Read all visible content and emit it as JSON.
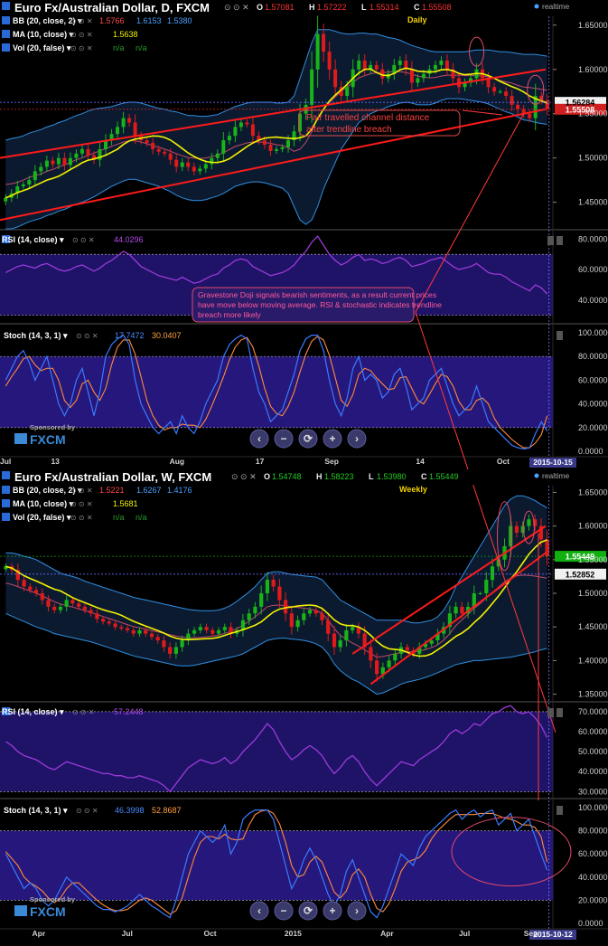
{
  "colors": {
    "bg": "#000000",
    "bb_fill": "#0c1a30",
    "bb_line": "#2f8fe0",
    "bb_mid": "#c04a6a",
    "ma": "#f2f200",
    "up": "#18b418",
    "down": "#e01a1a",
    "channel": "#ff1a1a",
    "rsi": "#9a3ad8",
    "stoch_k": "#3a7aff",
    "stoch_d": "#ff8a3a",
    "osc_fill": "#2a1a8a",
    "axis_text": "#d0d0d0",
    "grid": "#5a5a9a"
  },
  "charts": [
    {
      "id": "daily",
      "header": {
        "title": "Euro Fx/Australian Dollar, D, FXCM",
        "o_label": "O",
        "o": "1.57081",
        "h_label": "H",
        "h": "1.57222",
        "l_label": "L",
        "l": "1.55314",
        "c_label": "C",
        "c": "1.55508",
        "realtime": "realtime",
        "timeframe": "Daily"
      },
      "studies": [
        {
          "label": "BB (20, close, 2)",
          "v1": "1.5766",
          "v2": "1.6153",
          "v3": "1.5380"
        },
        {
          "label": "MA (10, close)",
          "v1": "1.5638"
        },
        {
          "label": "Vol (20, false)",
          "v1": "n/a",
          "v2": "n/a"
        }
      ],
      "price_ticks": [
        "1.65000",
        "1.60000",
        "1.55000",
        "1.50000",
        "1.45000"
      ],
      "price_badges": [
        "1.56284",
        "1.55508"
      ],
      "annotation": "Pair travelled channel distance after trendline breach",
      "rsi": {
        "label": "RSI (14, close)",
        "value": "44.0296",
        "ticks": [
          "80.0000",
          "60.0000",
          "40.0000"
        ]
      },
      "rsi_annotation": "Gravestone Doji signals bearish sentiments, as a result current prices have move below moving average. RSI & stochastic indicates trendline breach more likely",
      "stoch": {
        "label": "Stoch (14, 3, 1)",
        "k": "17.7472",
        "d": "30.0407",
        "ticks": [
          "100.0000",
          "80.0000",
          "60.0000",
          "40.0000",
          "20.0000",
          "0.0000"
        ]
      },
      "sponsor": {
        "top": "Sponsored by",
        "brand": "FXCM"
      },
      "x_labels": [
        "Jul",
        "13",
        "Aug",
        "17",
        "Sep",
        "14",
        "Oct"
      ],
      "date_badge": "2015-10-15"
    },
    {
      "id": "weekly",
      "header": {
        "title": "Euro Fx/Australian Dollar, W, FXCM",
        "o_label": "O",
        "o": "1.54748",
        "h_label": "H",
        "h": "1.58223",
        "l_label": "L",
        "l": "1.53980",
        "c_label": "C",
        "c": "1.55449",
        "realtime": "realtime",
        "timeframe": "Weekly"
      },
      "studies": [
        {
          "label": "BB (20, close, 2)",
          "v1": "1.5221",
          "v2": "1.6267",
          "v3": "1.4176"
        },
        {
          "label": "MA (10, close)",
          "v1": "1.5681"
        },
        {
          "label": "Vol (20, false)",
          "v1": "n/a",
          "v2": "n/a"
        }
      ],
      "price_ticks": [
        "1.65000",
        "1.60000",
        "1.55000",
        "1.50000",
        "1.45000",
        "1.40000",
        "1.35000"
      ],
      "price_badges": [
        "1.55449",
        "1.52852"
      ],
      "rsi": {
        "label": "RSI (14, close)",
        "value": "57.2448",
        "ticks": [
          "70.0000",
          "60.0000",
          "50.0000",
          "40.0000",
          "30.0000"
        ]
      },
      "stoch": {
        "label": "Stoch (14, 3, 1)",
        "k": "46.3998",
        "d": "52.8687",
        "ticks": [
          "100.0000",
          "80.0000",
          "60.0000",
          "40.0000",
          "20.0000",
          "0.0000"
        ]
      },
      "sponsor": {
        "top": "Sponsored by",
        "brand": "FXCM"
      },
      "x_labels": [
        "Apr",
        "Jul",
        "Oct",
        "2015",
        "Apr",
        "Jul",
        "Sep"
      ],
      "date_badge": "2015-10-12"
    }
  ],
  "chart_data": [
    {
      "type": "candlestick",
      "title": "Euro Fx/Australian Dollar, D, FXCM",
      "ylim": [
        1.42,
        1.66
      ],
      "x_tick_labels": [
        "Jul",
        "13",
        "Aug",
        "17",
        "Sep",
        "14",
        "Oct"
      ],
      "close": [
        1.455,
        1.46,
        1.468,
        1.47,
        1.475,
        1.485,
        1.49,
        1.497,
        1.493,
        1.5,
        1.492,
        1.5,
        1.505,
        1.51,
        1.503,
        1.498,
        1.51,
        1.52,
        1.527,
        1.535,
        1.545,
        1.54,
        1.525,
        1.52,
        1.517,
        1.51,
        1.507,
        1.505,
        1.498,
        1.49,
        1.495,
        1.49,
        1.485,
        1.488,
        1.493,
        1.5,
        1.505,
        1.52,
        1.525,
        1.535,
        1.54,
        1.538,
        1.525,
        1.52,
        1.515,
        1.508,
        1.51,
        1.512,
        1.52,
        1.53,
        1.55,
        1.56,
        1.6,
        1.64,
        1.62,
        1.6,
        1.58,
        1.57,
        1.58,
        1.6,
        1.61,
        1.6,
        1.605,
        1.6,
        1.59,
        1.595,
        1.605,
        1.61,
        1.6,
        1.585,
        1.59,
        1.595,
        1.6,
        1.605,
        1.61,
        1.6,
        1.59,
        1.58,
        1.585,
        1.59,
        1.6,
        1.59,
        1.58,
        1.575,
        1.575,
        1.57,
        1.56,
        1.555,
        1.55,
        1.545,
        1.57,
        1.565,
        1.555
      ],
      "bb_upper": [
        1.52,
        1.522,
        1.523,
        1.525,
        1.528,
        1.53,
        1.532,
        1.535,
        1.537,
        1.54,
        1.542,
        1.545,
        1.548,
        1.55,
        1.553,
        1.555,
        1.556,
        1.557,
        1.558,
        1.56,
        1.562,
        1.563,
        1.563,
        1.562,
        1.56,
        1.558,
        1.556,
        1.555,
        1.553,
        1.552,
        1.55,
        1.548,
        1.548,
        1.547,
        1.547,
        1.548,
        1.549,
        1.552,
        1.555,
        1.558,
        1.56,
        1.562,
        1.563,
        1.563,
        1.563,
        1.563,
        1.562,
        1.562,
        1.563,
        1.57,
        1.59,
        1.61,
        1.63,
        1.645,
        1.645,
        1.645,
        1.643,
        1.641,
        1.64,
        1.64,
        1.641,
        1.641,
        1.64,
        1.64,
        1.638,
        1.636,
        1.635,
        1.633,
        1.63,
        1.627,
        1.625,
        1.623,
        1.621,
        1.62,
        1.62,
        1.62,
        1.62,
        1.62,
        1.62,
        1.621,
        1.622,
        1.622,
        1.622,
        1.621,
        1.62,
        1.62,
        1.619,
        1.618,
        1.617,
        1.617,
        1.617,
        1.616,
        1.615
      ],
      "bb_lower": [
        1.42,
        1.42,
        1.422,
        1.425,
        1.428,
        1.43,
        1.432,
        1.435,
        1.437,
        1.44,
        1.442,
        1.445,
        1.448,
        1.45,
        1.453,
        1.456,
        1.46,
        1.464,
        1.468,
        1.471,
        1.474,
        1.476,
        1.476,
        1.474,
        1.472,
        1.47,
        1.468,
        1.465,
        1.462,
        1.458,
        1.455,
        1.453,
        1.452,
        1.452,
        1.453,
        1.455,
        1.457,
        1.46,
        1.464,
        1.468,
        1.47,
        1.472,
        1.473,
        1.473,
        1.472,
        1.47,
        1.468,
        1.466,
        1.46,
        1.445,
        1.43,
        1.425,
        1.43,
        1.445,
        1.465,
        1.48,
        1.495,
        1.51,
        1.52,
        1.53,
        1.54,
        1.545,
        1.55,
        1.553,
        1.555,
        1.558,
        1.56,
        1.562,
        1.563,
        1.562,
        1.56,
        1.56,
        1.56,
        1.562,
        1.565,
        1.567,
        1.567,
        1.567,
        1.566,
        1.565,
        1.564,
        1.563,
        1.561,
        1.558,
        1.555,
        1.552,
        1.55,
        1.546,
        1.543,
        1.542,
        1.54,
        1.539,
        1.538
      ],
      "rsi": [
        58,
        60,
        62,
        63,
        62,
        61,
        63,
        64,
        62,
        60,
        59,
        60,
        62,
        63,
        61,
        59,
        61,
        64,
        66,
        69,
        72,
        70,
        66,
        62,
        60,
        58,
        56,
        55,
        54,
        53,
        55,
        53,
        51,
        52,
        54,
        56,
        57,
        61,
        63,
        66,
        67,
        66,
        62,
        60,
        58,
        56,
        57,
        58,
        60,
        63,
        68,
        72,
        78,
        82,
        76,
        70,
        66,
        63,
        65,
        68,
        70,
        66,
        67,
        66,
        64,
        65,
        67,
        68,
        66,
        62,
        63,
        64,
        66,
        67,
        68,
        65,
        62,
        60,
        61,
        62,
        64,
        61,
        58,
        57,
        57,
        55,
        52,
        50,
        48,
        46,
        50,
        48,
        44
      ],
      "stoch_k": [
        60,
        70,
        80,
        85,
        75,
        60,
        70,
        80,
        60,
        40,
        30,
        40,
        60,
        70,
        50,
        30,
        50,
        80,
        90,
        95,
        98,
        90,
        60,
        40,
        30,
        20,
        15,
        20,
        25,
        15,
        30,
        20,
        15,
        25,
        40,
        50,
        60,
        80,
        90,
        95,
        98,
        95,
        70,
        50,
        40,
        25,
        30,
        35,
        50,
        65,
        85,
        95,
        98,
        98,
        85,
        60,
        40,
        30,
        45,
        70,
        80,
        60,
        65,
        60,
        45,
        50,
        65,
        70,
        55,
        35,
        40,
        45,
        60,
        65,
        70,
        55,
        40,
        30,
        35,
        40,
        55,
        40,
        25,
        20,
        15,
        10,
        5,
        3,
        2,
        3,
        15,
        25,
        17
      ],
      "stoch_d": [
        55,
        63,
        70,
        78,
        80,
        73,
        68,
        70,
        70,
        60,
        43,
        37,
        43,
        57,
        60,
        50,
        43,
        53,
        73,
        88,
        94,
        94,
        82,
        63,
        43,
        30,
        22,
        18,
        20,
        20,
        23,
        22,
        22,
        20,
        27,
        38,
        50,
        63,
        77,
        88,
        94,
        96,
        88,
        72,
        53,
        38,
        32,
        30,
        38,
        50,
        67,
        82,
        93,
        97,
        94,
        81,
        62,
        43,
        38,
        48,
        65,
        70,
        68,
        62,
        57,
        52,
        53,
        62,
        63,
        53,
        43,
        40,
        48,
        57,
        65,
        63,
        55,
        42,
        35,
        35,
        43,
        45,
        40,
        28,
        20,
        15,
        10,
        6,
        3,
        3,
        7,
        14,
        30
      ]
    },
    {
      "type": "candlestick",
      "title": "Euro Fx/Australian Dollar, W, FXCM",
      "ylim": [
        1.34,
        1.66
      ],
      "x_tick_labels": [
        "Apr",
        "Jul",
        "Oct",
        "2015",
        "Apr",
        "Jul",
        "Sep"
      ],
      "close": [
        1.54,
        1.535,
        1.52,
        1.51,
        1.505,
        1.5,
        1.49,
        1.48,
        1.475,
        1.48,
        1.49,
        1.485,
        1.48,
        1.475,
        1.47,
        1.462,
        1.458,
        1.455,
        1.45,
        1.448,
        1.445,
        1.44,
        1.445,
        1.44,
        1.435,
        1.43,
        1.42,
        1.41,
        1.42,
        1.43,
        1.44,
        1.445,
        1.45,
        1.445,
        1.44,
        1.445,
        1.45,
        1.44,
        1.445,
        1.46,
        1.47,
        1.48,
        1.5,
        1.52,
        1.51,
        1.49,
        1.47,
        1.45,
        1.46,
        1.47,
        1.475,
        1.47,
        1.46,
        1.44,
        1.42,
        1.43,
        1.445,
        1.45,
        1.44,
        1.42,
        1.4,
        1.38,
        1.39,
        1.4,
        1.41,
        1.42,
        1.415,
        1.41,
        1.42,
        1.425,
        1.43,
        1.44,
        1.45,
        1.47,
        1.48,
        1.47,
        1.48,
        1.5,
        1.5,
        1.52,
        1.54,
        1.55,
        1.57,
        1.6,
        1.59,
        1.6,
        1.61,
        1.6,
        1.58,
        1.555
      ],
      "bb_upper": [
        1.56,
        1.56,
        1.558,
        1.555,
        1.553,
        1.55,
        1.545,
        1.54,
        1.535,
        1.53,
        1.527,
        1.525,
        1.522,
        1.518,
        1.515,
        1.512,
        1.509,
        1.506,
        1.503,
        1.5,
        1.497,
        1.494,
        1.492,
        1.49,
        1.488,
        1.486,
        1.484,
        1.482,
        1.48,
        1.478,
        1.476,
        1.475,
        1.474,
        1.474,
        1.474,
        1.475,
        1.478,
        1.482,
        1.488,
        1.495,
        1.502,
        1.51,
        1.52,
        1.53,
        1.532,
        1.532,
        1.53,
        1.528,
        1.527,
        1.526,
        1.525,
        1.524,
        1.52,
        1.51,
        1.5,
        1.49,
        1.485,
        1.48,
        1.475,
        1.47,
        1.465,
        1.46,
        1.46,
        1.46,
        1.46,
        1.46,
        1.458,
        1.456,
        1.456,
        1.458,
        1.46,
        1.465,
        1.475,
        1.49,
        1.51,
        1.525,
        1.54,
        1.555,
        1.57,
        1.585,
        1.6,
        1.615,
        1.63,
        1.64,
        1.645,
        1.645,
        1.642,
        1.638,
        1.632,
        1.627
      ],
      "bb_lower": [
        1.47,
        1.466,
        1.462,
        1.458,
        1.454,
        1.45,
        1.447,
        1.444,
        1.44,
        1.438,
        1.436,
        1.434,
        1.432,
        1.43,
        1.428,
        1.425,
        1.422,
        1.419,
        1.416,
        1.413,
        1.41,
        1.407,
        1.405,
        1.403,
        1.401,
        1.399,
        1.397,
        1.395,
        1.393,
        1.392,
        1.392,
        1.393,
        1.395,
        1.397,
        1.399,
        1.401,
        1.403,
        1.405,
        1.407,
        1.41,
        1.415,
        1.42,
        1.425,
        1.43,
        1.432,
        1.433,
        1.433,
        1.432,
        1.431,
        1.43,
        1.428,
        1.425,
        1.42,
        1.41,
        1.395,
        1.385,
        1.378,
        1.372,
        1.368,
        1.362,
        1.356,
        1.35,
        1.352,
        1.356,
        1.36,
        1.365,
        1.368,
        1.37,
        1.372,
        1.375,
        1.378,
        1.382,
        1.386,
        1.39,
        1.394,
        1.396,
        1.398,
        1.4,
        1.4,
        1.401,
        1.402,
        1.403,
        1.404,
        1.405,
        1.407,
        1.409,
        1.411,
        1.413,
        1.416,
        1.418
      ],
      "rsi": [
        55,
        53,
        50,
        48,
        47,
        46,
        44,
        42,
        41,
        43,
        45,
        44,
        43,
        42,
        41,
        40,
        39,
        39,
        38,
        38,
        37,
        37,
        38,
        37,
        36,
        35,
        33,
        30,
        34,
        38,
        42,
        44,
        46,
        45,
        44,
        45,
        47,
        44,
        46,
        50,
        53,
        56,
        60,
        64,
        61,
        55,
        50,
        46,
        48,
        51,
        53,
        51,
        48,
        43,
        39,
        42,
        46,
        48,
        45,
        40,
        36,
        33,
        36,
        39,
        42,
        45,
        44,
        43,
        46,
        48,
        50,
        52,
        55,
        59,
        61,
        59,
        61,
        64,
        63,
        66,
        69,
        70,
        72,
        73,
        70,
        69,
        70,
        67,
        63,
        57
      ],
      "stoch_k": [
        60,
        50,
        40,
        30,
        35,
        30,
        20,
        15,
        20,
        30,
        40,
        35,
        30,
        25,
        20,
        15,
        12,
        12,
        10,
        12,
        15,
        20,
        25,
        20,
        15,
        12,
        8,
        5,
        20,
        40,
        60,
        70,
        80,
        75,
        70,
        75,
        85,
        60,
        70,
        90,
        95,
        98,
        98,
        98,
        90,
        70,
        50,
        30,
        40,
        55,
        65,
        55,
        40,
        25,
        15,
        25,
        45,
        55,
        40,
        25,
        10,
        5,
        15,
        30,
        45,
        60,
        55,
        50,
        65,
        75,
        80,
        85,
        90,
        95,
        98,
        90,
        95,
        98,
        92,
        96,
        98,
        85,
        90,
        95,
        80,
        85,
        90,
        75,
        60,
        46
      ],
      "stoch_d": [
        62,
        56,
        50,
        40,
        35,
        32,
        28,
        22,
        18,
        22,
        30,
        35,
        35,
        30,
        25,
        20,
        16,
        13,
        11,
        11,
        12,
        16,
        20,
        22,
        20,
        16,
        12,
        8,
        11,
        22,
        40,
        57,
        70,
        75,
        75,
        73,
        77,
        73,
        72,
        73,
        85,
        94,
        97,
        98,
        95,
        86,
        70,
        50,
        40,
        42,
        53,
        58,
        53,
        40,
        27,
        22,
        28,
        42,
        47,
        40,
        25,
        13,
        10,
        17,
        30,
        45,
        53,
        55,
        57,
        63,
        73,
        80,
        85,
        90,
        94,
        94,
        94,
        94,
        95,
        95,
        95,
        93,
        91,
        90,
        88,
        85,
        85,
        83,
        75,
        53
      ]
    }
  ]
}
